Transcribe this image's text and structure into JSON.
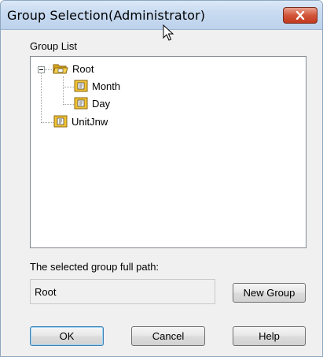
{
  "window": {
    "title": "Group Selection(Administrator)"
  },
  "group_list": {
    "label": "Group List",
    "tree": [
      {
        "label": "Root",
        "icon": "folder-open-icon",
        "children": [
          {
            "label": "Month",
            "icon": "group-folder-icon"
          },
          {
            "label": "Day",
            "icon": "group-folder-icon"
          }
        ]
      },
      {
        "label": "UnitJnw",
        "icon": "group-folder-icon"
      }
    ]
  },
  "path": {
    "label": "The selected group full path:",
    "value": "Root"
  },
  "buttons": {
    "new_group": "New Group",
    "ok": "OK",
    "cancel": "Cancel",
    "help": "Help"
  },
  "colors": {
    "titlebar": "#c7daf0",
    "close": "#c94a2e",
    "folder": "#f2c434"
  }
}
